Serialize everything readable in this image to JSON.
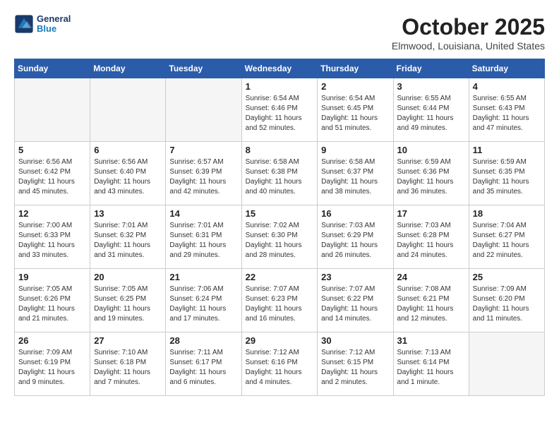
{
  "header": {
    "logo_line1": "General",
    "logo_line2": "Blue",
    "title": "October 2025",
    "subtitle": "Elmwood, Louisiana, United States"
  },
  "weekdays": [
    "Sunday",
    "Monday",
    "Tuesday",
    "Wednesday",
    "Thursday",
    "Friday",
    "Saturday"
  ],
  "weeks": [
    [
      {
        "day": "",
        "info": ""
      },
      {
        "day": "",
        "info": ""
      },
      {
        "day": "",
        "info": ""
      },
      {
        "day": "1",
        "info": "Sunrise: 6:54 AM\nSunset: 6:46 PM\nDaylight: 11 hours\nand 52 minutes."
      },
      {
        "day": "2",
        "info": "Sunrise: 6:54 AM\nSunset: 6:45 PM\nDaylight: 11 hours\nand 51 minutes."
      },
      {
        "day": "3",
        "info": "Sunrise: 6:55 AM\nSunset: 6:44 PM\nDaylight: 11 hours\nand 49 minutes."
      },
      {
        "day": "4",
        "info": "Sunrise: 6:55 AM\nSunset: 6:43 PM\nDaylight: 11 hours\nand 47 minutes."
      }
    ],
    [
      {
        "day": "5",
        "info": "Sunrise: 6:56 AM\nSunset: 6:42 PM\nDaylight: 11 hours\nand 45 minutes."
      },
      {
        "day": "6",
        "info": "Sunrise: 6:56 AM\nSunset: 6:40 PM\nDaylight: 11 hours\nand 43 minutes."
      },
      {
        "day": "7",
        "info": "Sunrise: 6:57 AM\nSunset: 6:39 PM\nDaylight: 11 hours\nand 42 minutes."
      },
      {
        "day": "8",
        "info": "Sunrise: 6:58 AM\nSunset: 6:38 PM\nDaylight: 11 hours\nand 40 minutes."
      },
      {
        "day": "9",
        "info": "Sunrise: 6:58 AM\nSunset: 6:37 PM\nDaylight: 11 hours\nand 38 minutes."
      },
      {
        "day": "10",
        "info": "Sunrise: 6:59 AM\nSunset: 6:36 PM\nDaylight: 11 hours\nand 36 minutes."
      },
      {
        "day": "11",
        "info": "Sunrise: 6:59 AM\nSunset: 6:35 PM\nDaylight: 11 hours\nand 35 minutes."
      }
    ],
    [
      {
        "day": "12",
        "info": "Sunrise: 7:00 AM\nSunset: 6:33 PM\nDaylight: 11 hours\nand 33 minutes."
      },
      {
        "day": "13",
        "info": "Sunrise: 7:01 AM\nSunset: 6:32 PM\nDaylight: 11 hours\nand 31 minutes."
      },
      {
        "day": "14",
        "info": "Sunrise: 7:01 AM\nSunset: 6:31 PM\nDaylight: 11 hours\nand 29 minutes."
      },
      {
        "day": "15",
        "info": "Sunrise: 7:02 AM\nSunset: 6:30 PM\nDaylight: 11 hours\nand 28 minutes."
      },
      {
        "day": "16",
        "info": "Sunrise: 7:03 AM\nSunset: 6:29 PM\nDaylight: 11 hours\nand 26 minutes."
      },
      {
        "day": "17",
        "info": "Sunrise: 7:03 AM\nSunset: 6:28 PM\nDaylight: 11 hours\nand 24 minutes."
      },
      {
        "day": "18",
        "info": "Sunrise: 7:04 AM\nSunset: 6:27 PM\nDaylight: 11 hours\nand 22 minutes."
      }
    ],
    [
      {
        "day": "19",
        "info": "Sunrise: 7:05 AM\nSunset: 6:26 PM\nDaylight: 11 hours\nand 21 minutes."
      },
      {
        "day": "20",
        "info": "Sunrise: 7:05 AM\nSunset: 6:25 PM\nDaylight: 11 hours\nand 19 minutes."
      },
      {
        "day": "21",
        "info": "Sunrise: 7:06 AM\nSunset: 6:24 PM\nDaylight: 11 hours\nand 17 minutes."
      },
      {
        "day": "22",
        "info": "Sunrise: 7:07 AM\nSunset: 6:23 PM\nDaylight: 11 hours\nand 16 minutes."
      },
      {
        "day": "23",
        "info": "Sunrise: 7:07 AM\nSunset: 6:22 PM\nDaylight: 11 hours\nand 14 minutes."
      },
      {
        "day": "24",
        "info": "Sunrise: 7:08 AM\nSunset: 6:21 PM\nDaylight: 11 hours\nand 12 minutes."
      },
      {
        "day": "25",
        "info": "Sunrise: 7:09 AM\nSunset: 6:20 PM\nDaylight: 11 hours\nand 11 minutes."
      }
    ],
    [
      {
        "day": "26",
        "info": "Sunrise: 7:09 AM\nSunset: 6:19 PM\nDaylight: 11 hours\nand 9 minutes."
      },
      {
        "day": "27",
        "info": "Sunrise: 7:10 AM\nSunset: 6:18 PM\nDaylight: 11 hours\nand 7 minutes."
      },
      {
        "day": "28",
        "info": "Sunrise: 7:11 AM\nSunset: 6:17 PM\nDaylight: 11 hours\nand 6 minutes."
      },
      {
        "day": "29",
        "info": "Sunrise: 7:12 AM\nSunset: 6:16 PM\nDaylight: 11 hours\nand 4 minutes."
      },
      {
        "day": "30",
        "info": "Sunrise: 7:12 AM\nSunset: 6:15 PM\nDaylight: 11 hours\nand 2 minutes."
      },
      {
        "day": "31",
        "info": "Sunrise: 7:13 AM\nSunset: 6:14 PM\nDaylight: 11 hours\nand 1 minute."
      },
      {
        "day": "",
        "info": ""
      }
    ]
  ]
}
